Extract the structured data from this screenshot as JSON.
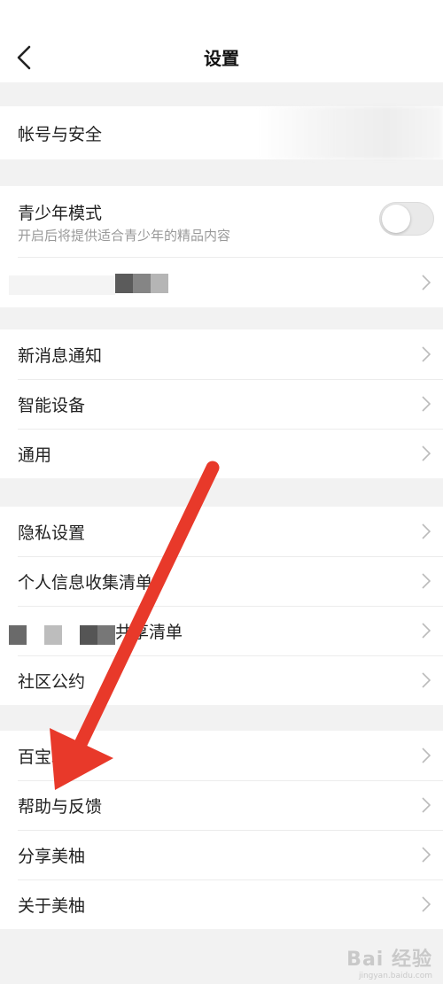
{
  "header": {
    "title": "设置"
  },
  "groups": {
    "account": {
      "items": [
        {
          "label": "帐号与安全"
        }
      ]
    },
    "youth": {
      "mode_label": "青少年模式",
      "mode_desc": "开启后将提供适合青少年的精品内容",
      "mode_on": false
    },
    "general": {
      "items": [
        {
          "label": "新消息通知"
        },
        {
          "label": "智能设备"
        },
        {
          "label": "通用"
        }
      ]
    },
    "privacy": {
      "items": [
        {
          "label": "隐私设置"
        },
        {
          "label": "个人信息收集清单"
        },
        {
          "label": "共享清单"
        },
        {
          "label": "社区公约"
        }
      ]
    },
    "more": {
      "items": [
        {
          "label": "百宝箱"
        },
        {
          "label": "帮助与反馈"
        },
        {
          "label": "分享美柚"
        },
        {
          "label": "关于美柚"
        }
      ]
    }
  },
  "watermark": {
    "brand": "Bai 经验",
    "url": "jingyan.baidu.com"
  },
  "colors": {
    "annotation_arrow": "#e8392a",
    "toggle_off": "#e9e9e9"
  }
}
